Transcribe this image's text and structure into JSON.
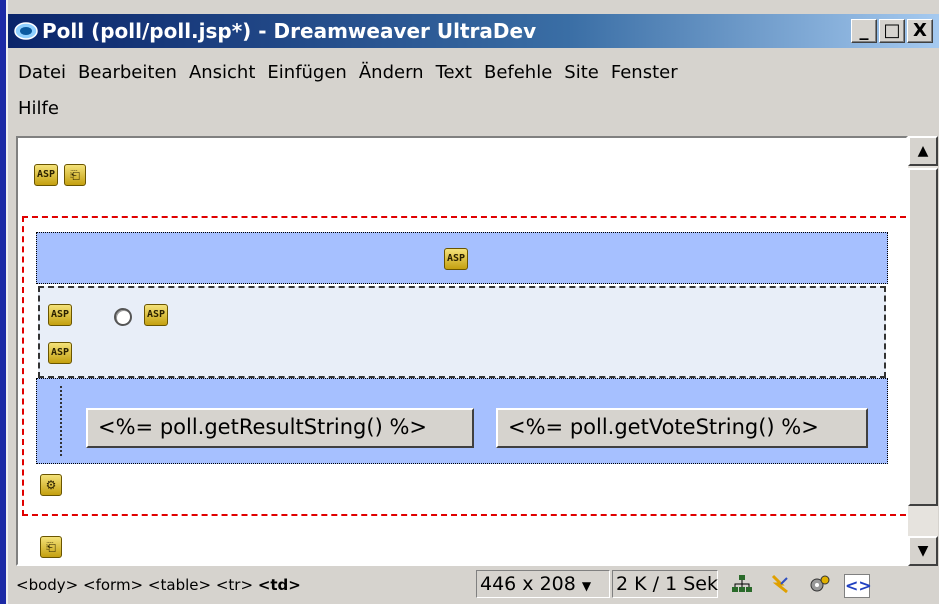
{
  "window": {
    "title": "Poll (poll/poll.jsp*) - Dreamweaver UltraDev",
    "minimize_label": "_",
    "maximize_label": "□",
    "close_label": "X"
  },
  "menu": {
    "row1": [
      "Datei",
      "Bearbeiten",
      "Ansicht",
      "Einfügen",
      "Ändern",
      "Text",
      "Befehle",
      "Site",
      "Fenster"
    ],
    "row2": [
      "Hilfe"
    ]
  },
  "document": {
    "asp_label": "ASP",
    "buttons": {
      "result": "<%= poll.getResultString() %>",
      "vote": "<%= poll.getVoteString() %>"
    }
  },
  "statusbar": {
    "tags": [
      "<body>",
      "<form>",
      "<table>",
      "<tr>"
    ],
    "current_tag": "<td>",
    "window_size": "446 x 208",
    "download": "2 K / 1 Sek"
  },
  "icons": {
    "app": "dreamweaver-icon",
    "site": "site-window-icon",
    "assets": "assets-icon",
    "behaviors": "behaviors-icon",
    "html_source": "html-source-icon"
  }
}
